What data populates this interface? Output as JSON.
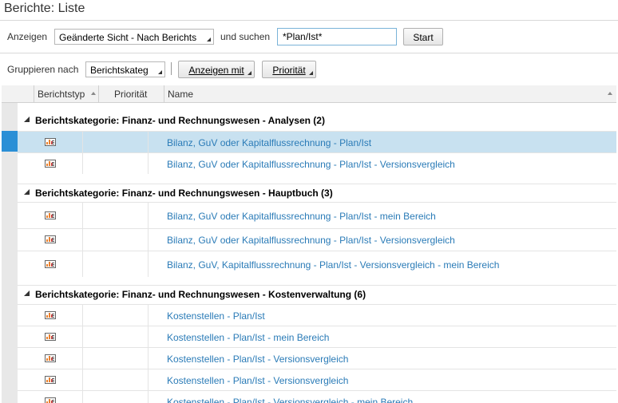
{
  "page": {
    "title": "Berichte: Liste"
  },
  "toolbar": {
    "anzeigen_label": "Anzeigen",
    "view_select": "Geänderte Sicht - Nach Berichts",
    "und_suchen_label": "und suchen",
    "search_value": "*Plan/Ist*",
    "start_label": "Start"
  },
  "grouping": {
    "label": "Gruppieren nach",
    "select": "Berichtskateg",
    "anzeigen_mit": "Anzeigen mit",
    "prioritaet": "Priorität"
  },
  "table": {
    "columns": [
      "Berichtstyp",
      "Priorität",
      "Name"
    ],
    "groups": [
      {
        "title": "Berichtskategorie: Finanz- und Rechnungswesen - Analysen (2)"
      },
      {
        "title": "Berichtskategorie: Finanz- und Rechnungswesen - Hauptbuch (3)"
      },
      {
        "title": "Berichtskategorie: Finanz- und Rechnungswesen - Kostenverwaltung (6)"
      }
    ],
    "rows": [
      "Bilanz, GuV oder Kapitalflussrechnung - Plan/Ist",
      "Bilanz, GuV oder Kapitalflussrechnung - Plan/Ist - Versionsvergleich",
      "Bilanz, GuV oder Kapitalflussrechnung - Plan/Ist - mein Bereich",
      "Bilanz, GuV oder Kapitalflussrechnung - Plan/Ist - Versionsvergleich",
      "Bilanz, GuV, Kapitalflussrechnung - Plan/Ist - Versionsvergleich - mein Bereich",
      "Kostenstellen - Plan/Ist",
      "Kostenstellen - Plan/Ist - mein Bereich",
      "Kostenstellen - Plan/Ist - Versionsvergleich",
      "Kostenstellen - Plan/Ist - Versionsvergleich",
      "Kostenstellen - Plan/Ist - Versionsvergleich - mein Bereich"
    ]
  },
  "colors": {
    "link": "#2a7bb7",
    "selected_row": "#c8e1f0",
    "marker": "#2a8fd6"
  }
}
